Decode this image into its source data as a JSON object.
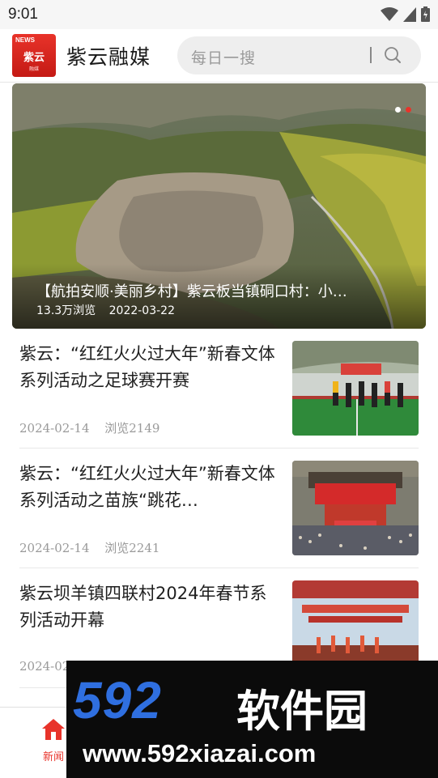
{
  "status_bar": {
    "time": "9:01"
  },
  "header": {
    "logo_news": "NEWS",
    "logo_name": "紫云",
    "logo_sub": "融媒",
    "app_title": "紫云融媒",
    "search_placeholder": "每日一搜"
  },
  "banner": {
    "title": "【航拍安顺·美丽乡村】紫云板当镇硐口村：小…",
    "views": "13.3万浏览",
    "date": "2022-03-22",
    "page_count": 2,
    "active_page": 2
  },
  "news": [
    {
      "title": "紫云：“红红火火过大年”新春文体系列活动之足球赛开赛",
      "date": "2024-02-14",
      "views": "浏览2149"
    },
    {
      "title": "紫云：“红红火火过大年”新春文体系列活动之苗族“跳花…",
      "date": "2024-02-14",
      "views": "浏览2241"
    },
    {
      "title": "紫云坝羊镇四联村2024年春节系列活动开幕",
      "date": "2024-02",
      "views": ""
    }
  ],
  "bottom_nav": [
    {
      "label": "新闻",
      "icon": "home-icon",
      "active": true
    }
  ],
  "watermark": {
    "number": "592",
    "brand": "软件园",
    "url": "www.592xiazai.com"
  },
  "colors": {
    "accent": "#e8332a",
    "watermark_blue": "#2f6fe0"
  }
}
